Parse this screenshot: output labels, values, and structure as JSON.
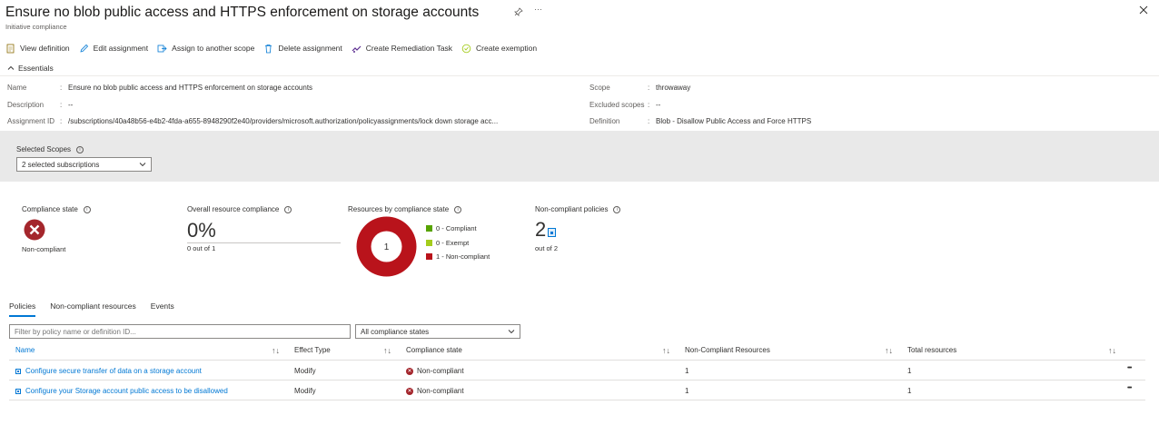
{
  "header": {
    "title": "Ensure no blob public access and HTTPS enforcement on storage accounts",
    "subtitle": "Initiative compliance"
  },
  "toolbar": {
    "view_definition": "View definition",
    "edit_assignment": "Edit assignment",
    "assign_to_another_scope": "Assign to another scope",
    "delete_assignment": "Delete assignment",
    "create_remediation_task": "Create Remediation Task",
    "create_exemption": "Create exemption"
  },
  "essentials": {
    "heading": "Essentials",
    "name_label": "Name",
    "name_value": "Ensure no blob public access and HTTPS enforcement on storage accounts",
    "description_label": "Description",
    "description_value": "--",
    "assignment_id_label": "Assignment ID",
    "assignment_id_value": "/subscriptions/40a48b56-e4b2-4fda-a655-8948290f2e40/providers/microsoft.authorization/policyassignments/lock down storage acc...",
    "scope_label": "Scope",
    "scope_value": "throwaway",
    "excluded_scopes_label": "Excluded scopes",
    "excluded_scopes_value": "--",
    "definition_label": "Definition",
    "definition_value": "Blob - Disallow Public Access and Force HTTPS",
    "colon": ":"
  },
  "scopes": {
    "label": "Selected Scopes",
    "value": "2 selected subscriptions"
  },
  "summary": {
    "compliance_state_title": "Compliance state",
    "compliance_state_value": "Non-compliant",
    "overall_title": "Overall resource compliance",
    "overall_percent": "0%",
    "overall_sub": "0 out of 1",
    "overall_fraction": 0,
    "donut_title": "Resources by compliance state",
    "donut_center": "1",
    "legend": [
      {
        "label": "0 - Compliant",
        "color": "#57a300",
        "count": 0
      },
      {
        "label": "0 - Exempt",
        "color": "#a4cc1c",
        "count": 0
      },
      {
        "label": "1 - Non-compliant",
        "color": "#b9131b",
        "count": 1
      }
    ],
    "ncp_title": "Non-compliant policies",
    "ncp_value": "2",
    "ncp_sub": "out of 2"
  },
  "tabs": [
    {
      "label": "Policies",
      "active": true
    },
    {
      "label": "Non-compliant resources",
      "active": false
    },
    {
      "label": "Events",
      "active": false
    }
  ],
  "filter": {
    "placeholder": "Filter by policy name or definition ID...",
    "state_select": "All compliance states"
  },
  "table": {
    "headers": [
      "Name",
      "Effect Type",
      "Compliance state",
      "Non-Compliant Resources",
      "Total resources"
    ],
    "sort_glyph": "↑↓",
    "more_glyph": "•••",
    "rows": [
      {
        "name": "Configure secure transfer of data on a storage account",
        "effect": "Modify",
        "state": "Non-compliant",
        "noncompliant": "1",
        "total": "1"
      },
      {
        "name": "Configure your Storage account public access to be disallowed",
        "effect": "Modify",
        "state": "Non-compliant",
        "noncompliant": "1",
        "total": "1"
      }
    ]
  },
  "colors": {
    "accent": "#0078d4",
    "danger": "#a4262c",
    "donut_noncompliant": "#b9131b"
  },
  "icons": {
    "pin": "pin-icon",
    "more": "more-icon",
    "close": "close-icon"
  }
}
